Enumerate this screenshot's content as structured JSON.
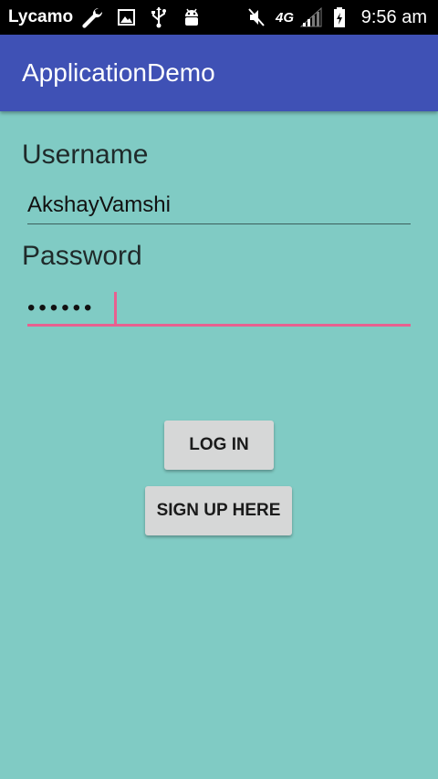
{
  "status_bar": {
    "carrier": "Lycamo",
    "network_label": "4G",
    "time": "9:56 am",
    "icons": [
      "wrench-icon",
      "image-icon",
      "usb-icon",
      "android-icon",
      "mute-icon",
      "signal-icon",
      "battery-icon"
    ]
  },
  "app_bar": {
    "title": "ApplicationDemo",
    "color": "#3f51b5"
  },
  "form": {
    "username_label": "Username",
    "username_value": "AkshayVamshi",
    "password_label": "Password",
    "password_value": "••••••"
  },
  "buttons": {
    "login_label": "LOG IN",
    "signup_label": "SIGN UP HERE"
  },
  "colors": {
    "background": "#80cbc4",
    "accent": "#e8608f",
    "button": "#d6d7d7"
  }
}
